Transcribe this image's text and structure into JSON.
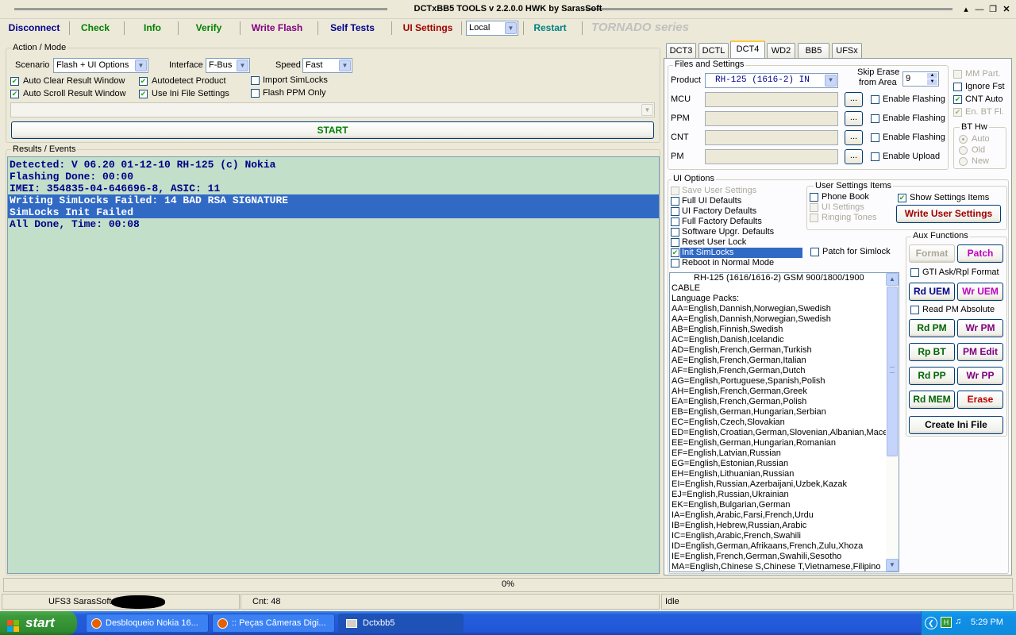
{
  "window": {
    "title": "DCTxBB5 TOOLS v 2.2.0.0 HWK by SarasSoft"
  },
  "toolbar": {
    "disconnect": "Disconnect",
    "check": "Check",
    "info": "Info",
    "verify": "Verify",
    "write_flash": "Write Flash",
    "self_tests": "Self Tests",
    "ui_settings": "UI Settings",
    "connection_mode": "Local",
    "restart": "Restart",
    "series": "TORNADO series"
  },
  "action_mode": {
    "title": "Action / Mode",
    "scenario_label": "Scenario",
    "scenario_value": "Flash + UI Options",
    "interface_label": "Interface",
    "interface_value": "F-Bus",
    "speed_label": "Speed",
    "speed_value": "Fast",
    "auto_clear": "Auto Clear Result Window",
    "auto_scroll": "Auto Scroll Result Window",
    "autodetect": "Autodetect Product",
    "use_ini": "Use Ini File Settings",
    "import_simlocks": "Import SimLocks",
    "flash_ppm_only": "Flash PPM Only",
    "start": "START"
  },
  "results": {
    "title": "Results / Events",
    "lines": [
      {
        "text": "Detected: V 06.20 01-12-10 RH-125 (c) Nokia",
        "selected": false
      },
      {
        "text": "Flashing Done: 00:00",
        "selected": false
      },
      {
        "text": "IMEI: 354835-04-646696-8, ASIC: 11",
        "selected": false
      },
      {
        "text": "Writing SimLocks Failed: 14 BAD RSA SIGNATURE",
        "selected": true
      },
      {
        "text": "SimLocks Init Failed",
        "selected": true
      },
      {
        "text": "All Done, Time: 00:08",
        "selected": false
      }
    ]
  },
  "tabs": [
    "DCT3",
    "DCTL",
    "DCT4",
    "WD2",
    "BB5",
    "UFSx"
  ],
  "active_tab": "DCT4",
  "files": {
    "title": "Files and Settings",
    "product_label": "Product",
    "product_value": "RH-125 (1616-2) IN",
    "skip_erase": "Skip Erase",
    "from_area": "from Area",
    "skip_value": "9",
    "rows": [
      {
        "label": "MCU",
        "opt": "Enable Flashing"
      },
      {
        "label": "PPM",
        "opt": "Enable Flashing"
      },
      {
        "label": "CNT",
        "opt": "Enable Flashing"
      },
      {
        "label": "PM",
        "opt": "Enable Upload"
      }
    ],
    "browse": "...",
    "mm_part": "MM Part.",
    "ignore_fst": "Ignore Fst",
    "cnt_auto": "CNT Auto",
    "en_bt": "En. BT Fl.",
    "bt_hw": "BT Hw",
    "bt_auto": "Auto",
    "bt_old": "Old",
    "bt_new": "New"
  },
  "ui_options": {
    "title": "UI Options",
    "items": [
      {
        "label": "Save User Settings",
        "checked": false,
        "disabled": true,
        "selected": false
      },
      {
        "label": "Full UI Defaults",
        "checked": false,
        "disabled": false,
        "selected": false
      },
      {
        "label": "UI Factory Defaults",
        "checked": false,
        "disabled": false,
        "selected": false
      },
      {
        "label": "Full Factory Defaults",
        "checked": false,
        "disabled": false,
        "selected": false
      },
      {
        "label": "Software Upgr. Defaults",
        "checked": false,
        "disabled": false,
        "selected": false
      },
      {
        "label": "Reset User Lock",
        "checked": false,
        "disabled": false,
        "selected": false
      },
      {
        "label": "Init SimLocks",
        "checked": true,
        "disabled": false,
        "selected": true
      },
      {
        "label": "Reboot in Normal Mode",
        "checked": false,
        "disabled": false,
        "selected": false
      }
    ],
    "patch_for_simlock": "Patch for Simlock"
  },
  "user_settings": {
    "title": "User Settings Items",
    "phone_book": "Phone Book",
    "ui_settings": "UI Settings",
    "ringing_tones": "Ringing Tones",
    "show_settings": "Show Settings Items",
    "write_user_settings": "Write User Settings"
  },
  "aux": {
    "title": "Aux Functions",
    "format": "Format",
    "patch": "Patch",
    "gti": "GTI Ask/Rpl Format",
    "rd_uem": "Rd UEM",
    "wr_uem": "Wr UEM",
    "read_pm_abs": "Read PM Absolute",
    "rd_pm": "Rd PM",
    "wr_pm": "Wr PM",
    "rp_bt": "Rp BT",
    "pm_edit": "PM Edit",
    "rd_pp": "Rd PP",
    "wr_pp": "Wr PP",
    "rd_mem": "Rd MEM",
    "erase": "Erase",
    "create_ini": "Create Ini File"
  },
  "info_list": [
    "RH-125 (1616/1616-2) GSM 900/1800/1900",
    "CABLE",
    "Language Packs:",
    "AA=English,Dannish,Norwegian,Swedish",
    "AA=English,Dannish,Norwegian,Swedish",
    "AB=English,Finnish,Swedish",
    "AC=English,Danish,Icelandic",
    "AD=English,French,German,Turkish",
    "AE=English,French,German,Italian",
    "AF=English,French,German,Dutch",
    "AG=English,Portuguese,Spanish,Polish",
    "AH=English,French,German,Greek",
    "EA=English,French,German,Polish",
    "EB=English,German,Hungarian,Serbian",
    "EC=English,Czech,Slovakian",
    "ED=English,Croatian,German,Slovenian,Albanian,Macedo",
    "EE=English,German,Hungarian,Romanian",
    "EF=English,Latvian,Russian",
    "EG=English,Estonian,Russian",
    "EH=English,Lithuanian,Russian",
    "EI=English,Russian,Azerbaijani,Uzbek,Kazak",
    "EJ=English,Russian,Ukrainian",
    "EK=English,Bulgarian,German",
    "IA=English,Arabic,Farsi,French,Urdu",
    "IB=English,Hebrew,Russian,Arabic",
    "IC=English,Arabic,French,Swahili",
    "ID=English,German,Afrikaans,French,Zulu,Xhoza",
    "IE=English,French,German,Swahili,Sesotho",
    "MA=English,Chinese S,Chinese T,Vietnamese,Filipino"
  ],
  "progress": {
    "text": "0%",
    "value": 0
  },
  "status": {
    "left": "UFS3 SarasSoft",
    "counter": "Cnt: 48",
    "state": "Idle"
  },
  "taskbar": {
    "start": "start",
    "tasks": [
      {
        "label": "Desbloqueio Nokia 16...",
        "active": false
      },
      {
        "label": ":: Peças Câmeras Digi...",
        "active": false
      },
      {
        "label": "Dctxbb5",
        "active": true
      }
    ],
    "clock": "5:29 PM"
  },
  "colors": {
    "check": "#008000",
    "info": "#008000",
    "verify": "#008000",
    "write_flash": "#800080",
    "self_tests": "#00008b",
    "ui_settings": "#a00000",
    "restart": "#008080",
    "series": "#c0c0c0",
    "results_bg": "#c2dfc9",
    "selection": "#316ac5",
    "aux_blue": "#00008b",
    "aux_magenta": "#c000c0",
    "aux_green": "#006400",
    "aux_red": "#c00000"
  }
}
